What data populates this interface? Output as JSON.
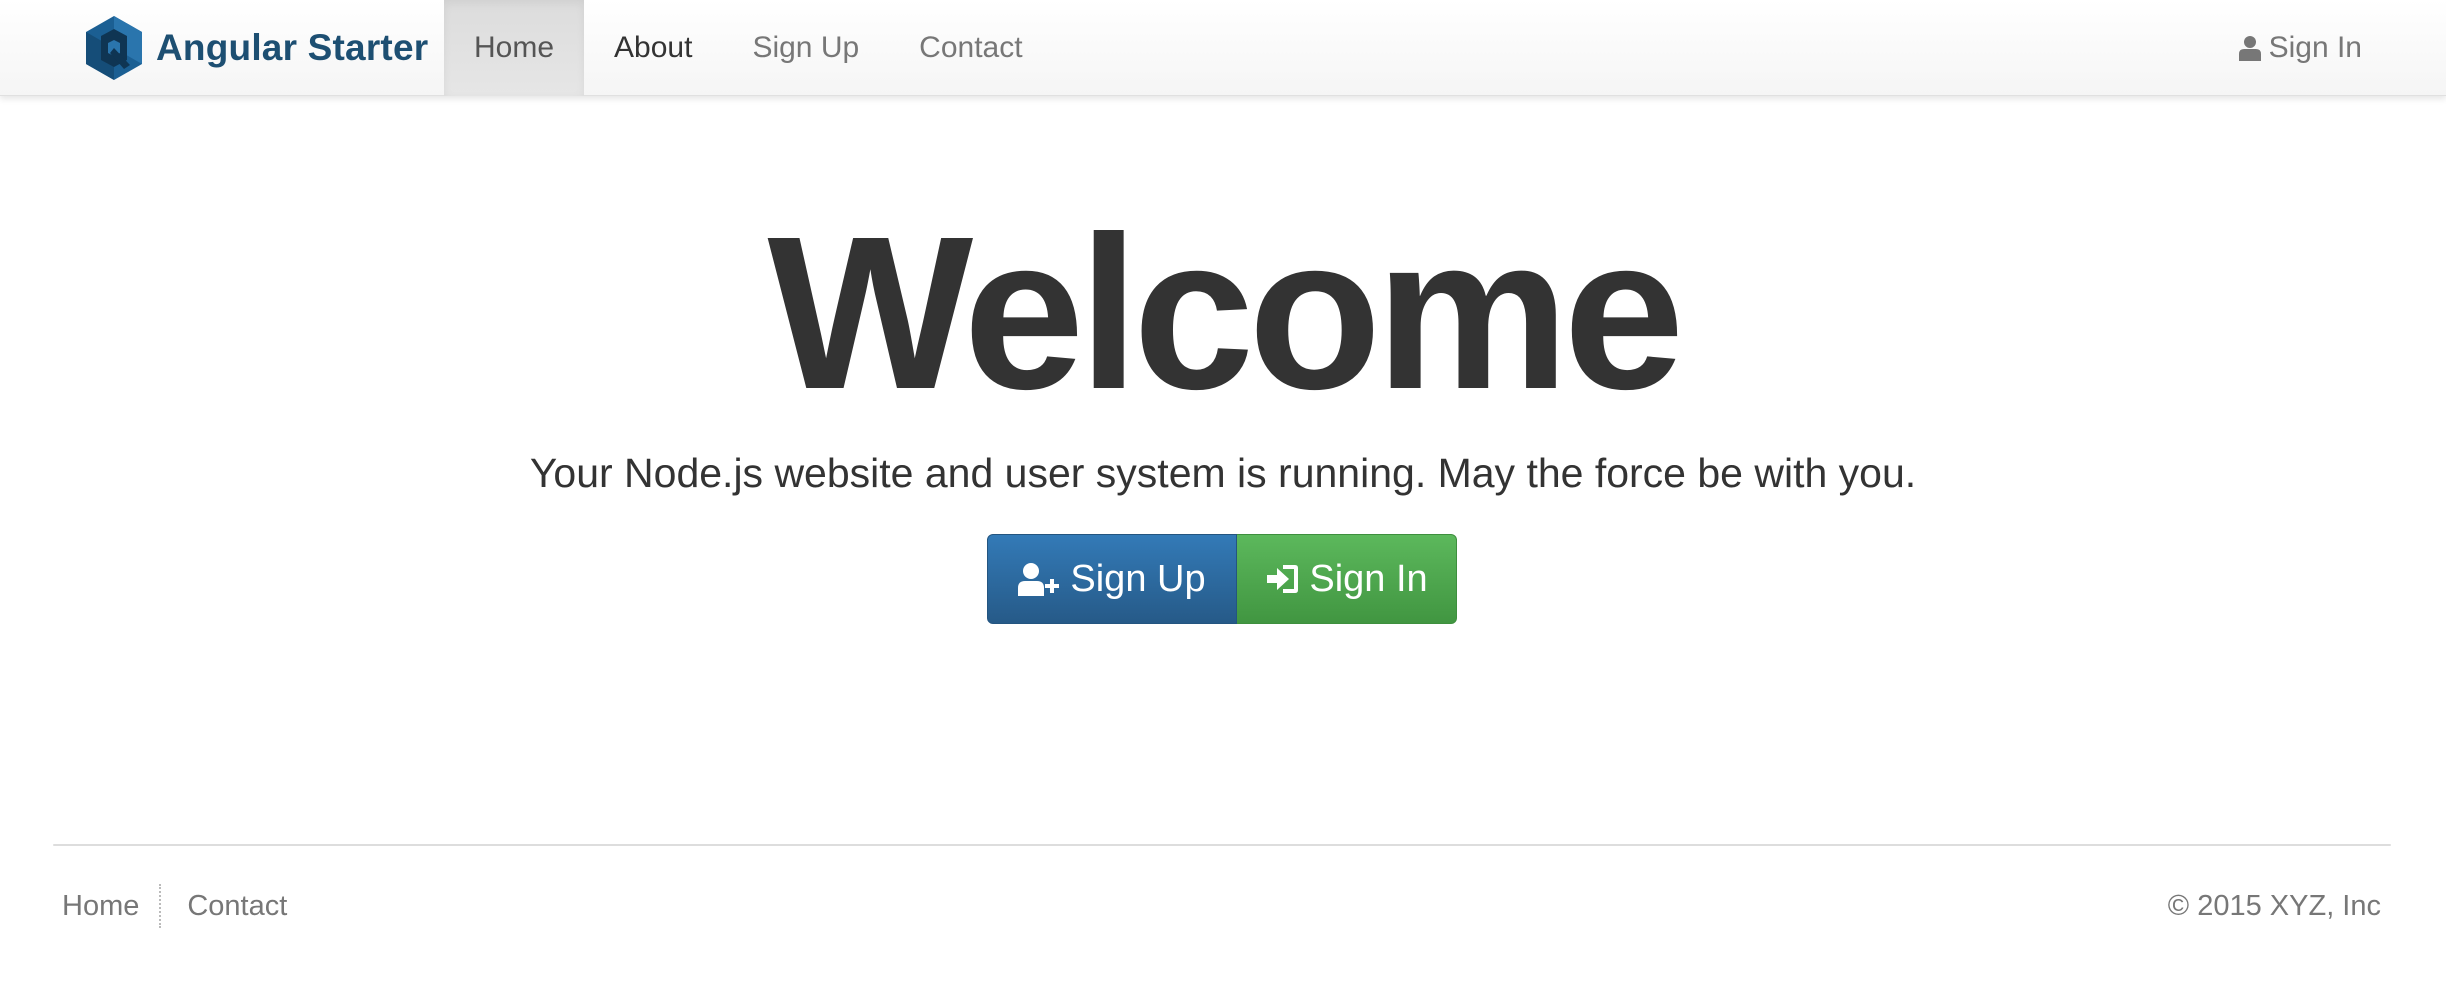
{
  "navbar": {
    "brand": "Angular Starter",
    "items": [
      {
        "label": "Home"
      },
      {
        "label": "About"
      },
      {
        "label": "Sign Up"
      },
      {
        "label": "Contact"
      }
    ],
    "active_item": "Home",
    "sign_in": "Sign In",
    "icons": {
      "logo": "hexagon-logo-icon",
      "sign_in": "user-icon"
    }
  },
  "hero": {
    "title": "Welcome",
    "subtitle": "Your Node.js website and user system is running. May the force be with you.",
    "signup_button": "Sign Up",
    "signin_button": "Sign In",
    "icons": {
      "signup": "user-plus-icon",
      "signin": "sign-in-icon"
    }
  },
  "footer": {
    "links": [
      {
        "label": "Home"
      },
      {
        "label": "Contact"
      }
    ],
    "copyright": "© 2015 XYZ, Inc"
  },
  "colors": {
    "brand_text": "#1d4f72",
    "primary": "#337ab7",
    "success": "#5cb85c",
    "muted": "#777777",
    "text": "#333333"
  }
}
